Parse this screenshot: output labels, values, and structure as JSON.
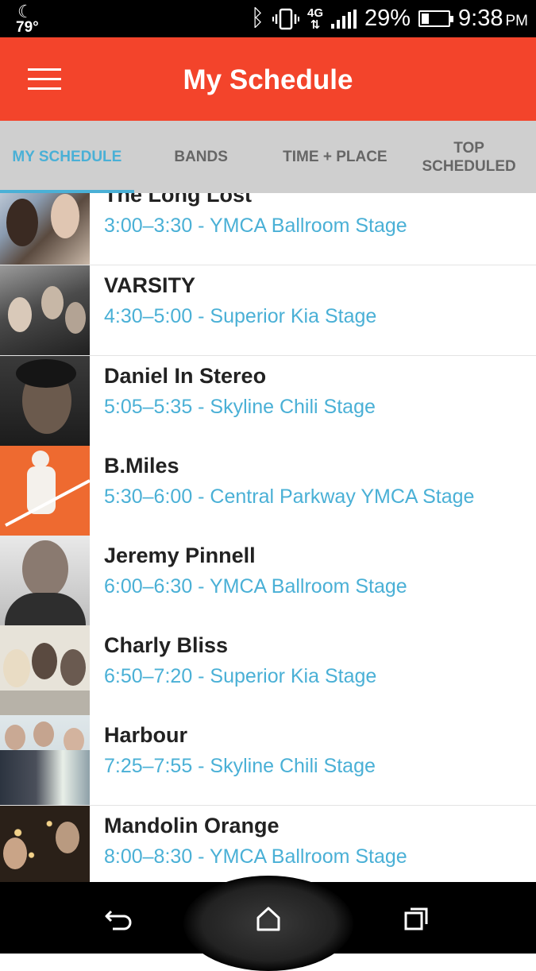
{
  "status_bar": {
    "temperature": "79°",
    "network": "4G",
    "battery_percent_label": "29%",
    "battery_level": 0.29,
    "time": "9:38",
    "ampm": "PM"
  },
  "app_bar": {
    "title": "My Schedule",
    "menu_icon": "hamburger-menu-icon"
  },
  "tabs": [
    {
      "label": "MY SCHEDULE",
      "active": true
    },
    {
      "label": "BANDS",
      "active": false
    },
    {
      "label": "TIME + PLACE",
      "active": false
    },
    {
      "label": "TOP SCHEDULED",
      "active": false
    }
  ],
  "schedule": [
    {
      "name": "The Long Lost",
      "time": "3:00–3:30 - YMCA Ballroom Stage"
    },
    {
      "name": "VARSITY",
      "time": "4:30–5:00 - Superior Kia Stage"
    },
    {
      "name": "Daniel In Stereo",
      "time": "5:05–5:35 - Skyline Chili Stage"
    },
    {
      "name": "B.Miles",
      "time": "5:30–6:00 - Central Parkway YMCA Stage"
    },
    {
      "name": "Jeremy Pinnell",
      "time": "6:00–6:30 - YMCA Ballroom Stage"
    },
    {
      "name": "Charly Bliss",
      "time": "6:50–7:20 - Superior Kia Stage"
    },
    {
      "name": "Harbour",
      "time": "7:25–7:55 - Skyline Chili Stage"
    },
    {
      "name": "Mandolin Orange",
      "time": "8:00–8:30 - YMCA Ballroom Stage"
    }
  ],
  "nav_bar": {
    "icons": [
      "back-icon",
      "home-icon",
      "recent-apps-icon"
    ]
  },
  "colors": {
    "accent": "#f3442b",
    "link_blue": "#4ab0d6",
    "tab_bg": "#cfcfcf"
  }
}
